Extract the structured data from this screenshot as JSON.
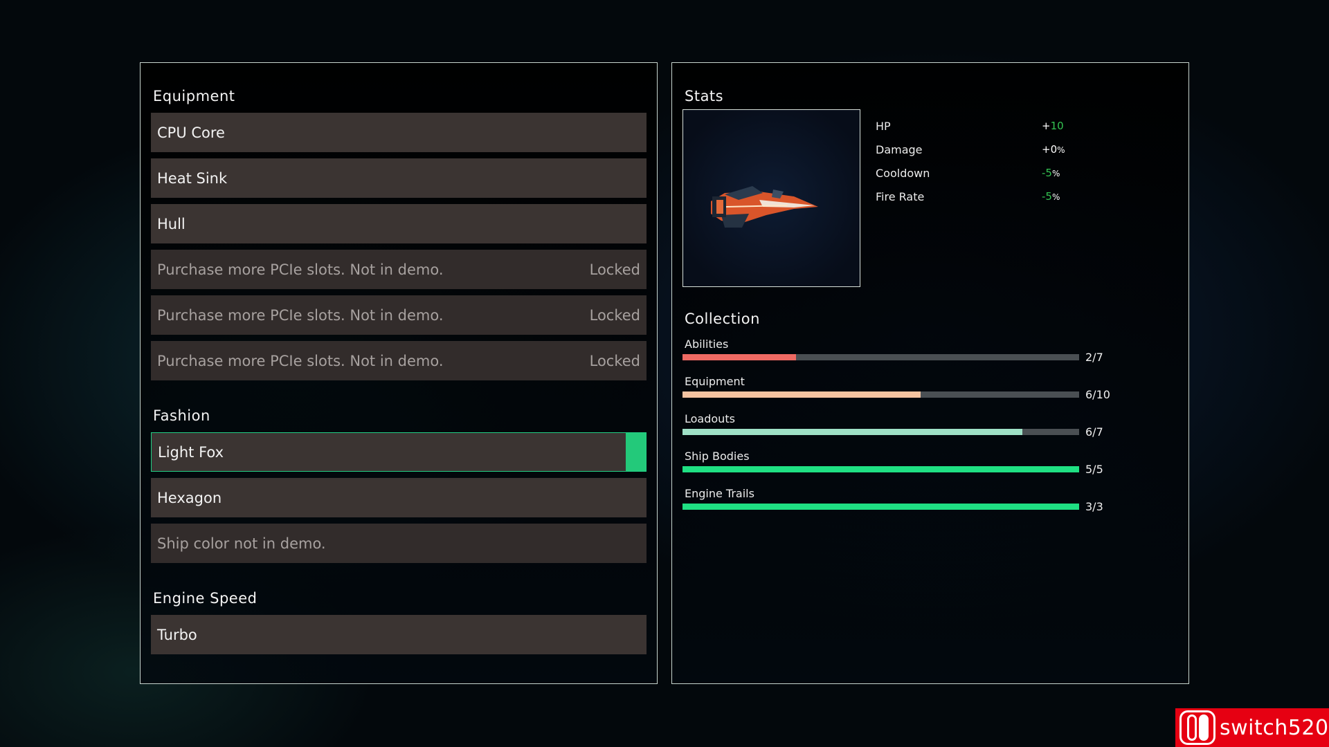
{
  "equipment": {
    "heading": "Equipment",
    "slots": [
      {
        "label": "CPU Core"
      },
      {
        "label": "Heat Sink"
      },
      {
        "label": "Hull"
      }
    ],
    "locked_slots": [
      {
        "label": "Purchase more PCIe slots. Not in demo.",
        "status": "Locked"
      },
      {
        "label": "Purchase more PCIe slots. Not in demo.",
        "status": "Locked"
      },
      {
        "label": "Purchase more PCIe slots. Not in demo.",
        "status": "Locked"
      }
    ]
  },
  "fashion": {
    "heading": "Fashion",
    "items": [
      {
        "label": "Light Fox",
        "selected": true
      },
      {
        "label": "Hexagon"
      },
      {
        "label": "Ship color not in demo.",
        "disabled": true
      }
    ]
  },
  "engine_speed": {
    "heading": "Engine Speed",
    "value": "Turbo"
  },
  "stats": {
    "heading": "Stats",
    "rows": [
      {
        "label": "HP",
        "sign": "+",
        "num": "10",
        "suffix": ""
      },
      {
        "label": "Damage",
        "sign": "+",
        "num": "0",
        "suffix": "%",
        "num_color": "#ffffff"
      },
      {
        "label": "Cooldown",
        "sign": "-",
        "num": "5",
        "suffix": "%"
      },
      {
        "label": "Fire Rate",
        "sign": "-",
        "num": "5",
        "suffix": "%"
      }
    ]
  },
  "collection": {
    "heading": "Collection",
    "rows": [
      {
        "label": "Abilities",
        "count": "2/7",
        "have": 2,
        "total": 7,
        "color": "#ef6a63"
      },
      {
        "label": "Equipment",
        "count": "6/10",
        "have": 6,
        "total": 10,
        "color": "#f6c3a0"
      },
      {
        "label": "Loadouts",
        "count": "6/7",
        "have": 6,
        "total": 7,
        "color": "#9fe0c6"
      },
      {
        "label": "Ship Bodies",
        "count": "5/5",
        "have": 5,
        "total": 5,
        "color": "#1fe083"
      },
      {
        "label": "Engine Trails",
        "count": "3/3",
        "have": 3,
        "total": 3,
        "color": "#1fe083"
      }
    ]
  },
  "watermark": {
    "text": "switch520"
  },
  "colors": {
    "accent_green": "#23c97a",
    "slot_bg": "#3b3432",
    "positive_stat": "#34c452"
  }
}
